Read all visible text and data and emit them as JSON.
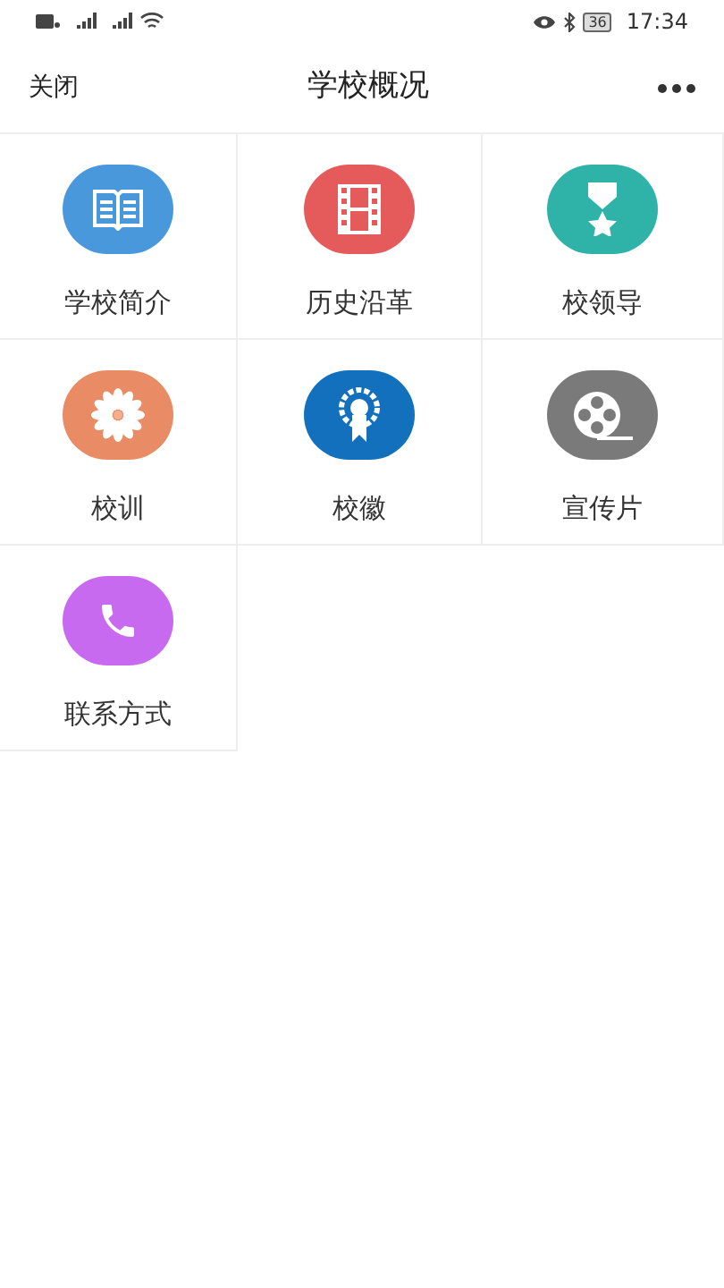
{
  "status_bar": {
    "battery": "36",
    "time": "17:34"
  },
  "nav": {
    "close": "关闭",
    "title": "学校概况"
  },
  "items": [
    {
      "kind": "book",
      "label": "学校简介",
      "color": "#4a98dc"
    },
    {
      "kind": "film",
      "label": "历史沿革",
      "color": "#e55b5b"
    },
    {
      "kind": "medal",
      "label": "校领导",
      "color": "#2fb3a8"
    },
    {
      "kind": "flower",
      "label": "校训",
      "color": "#e98c65"
    },
    {
      "kind": "badge",
      "label": "校徽",
      "color": "#1370bd"
    },
    {
      "kind": "reel",
      "label": "宣传片",
      "color": "#7a7a7a"
    },
    {
      "kind": "phone",
      "label": "联系方式",
      "color": "#c86af0"
    }
  ]
}
